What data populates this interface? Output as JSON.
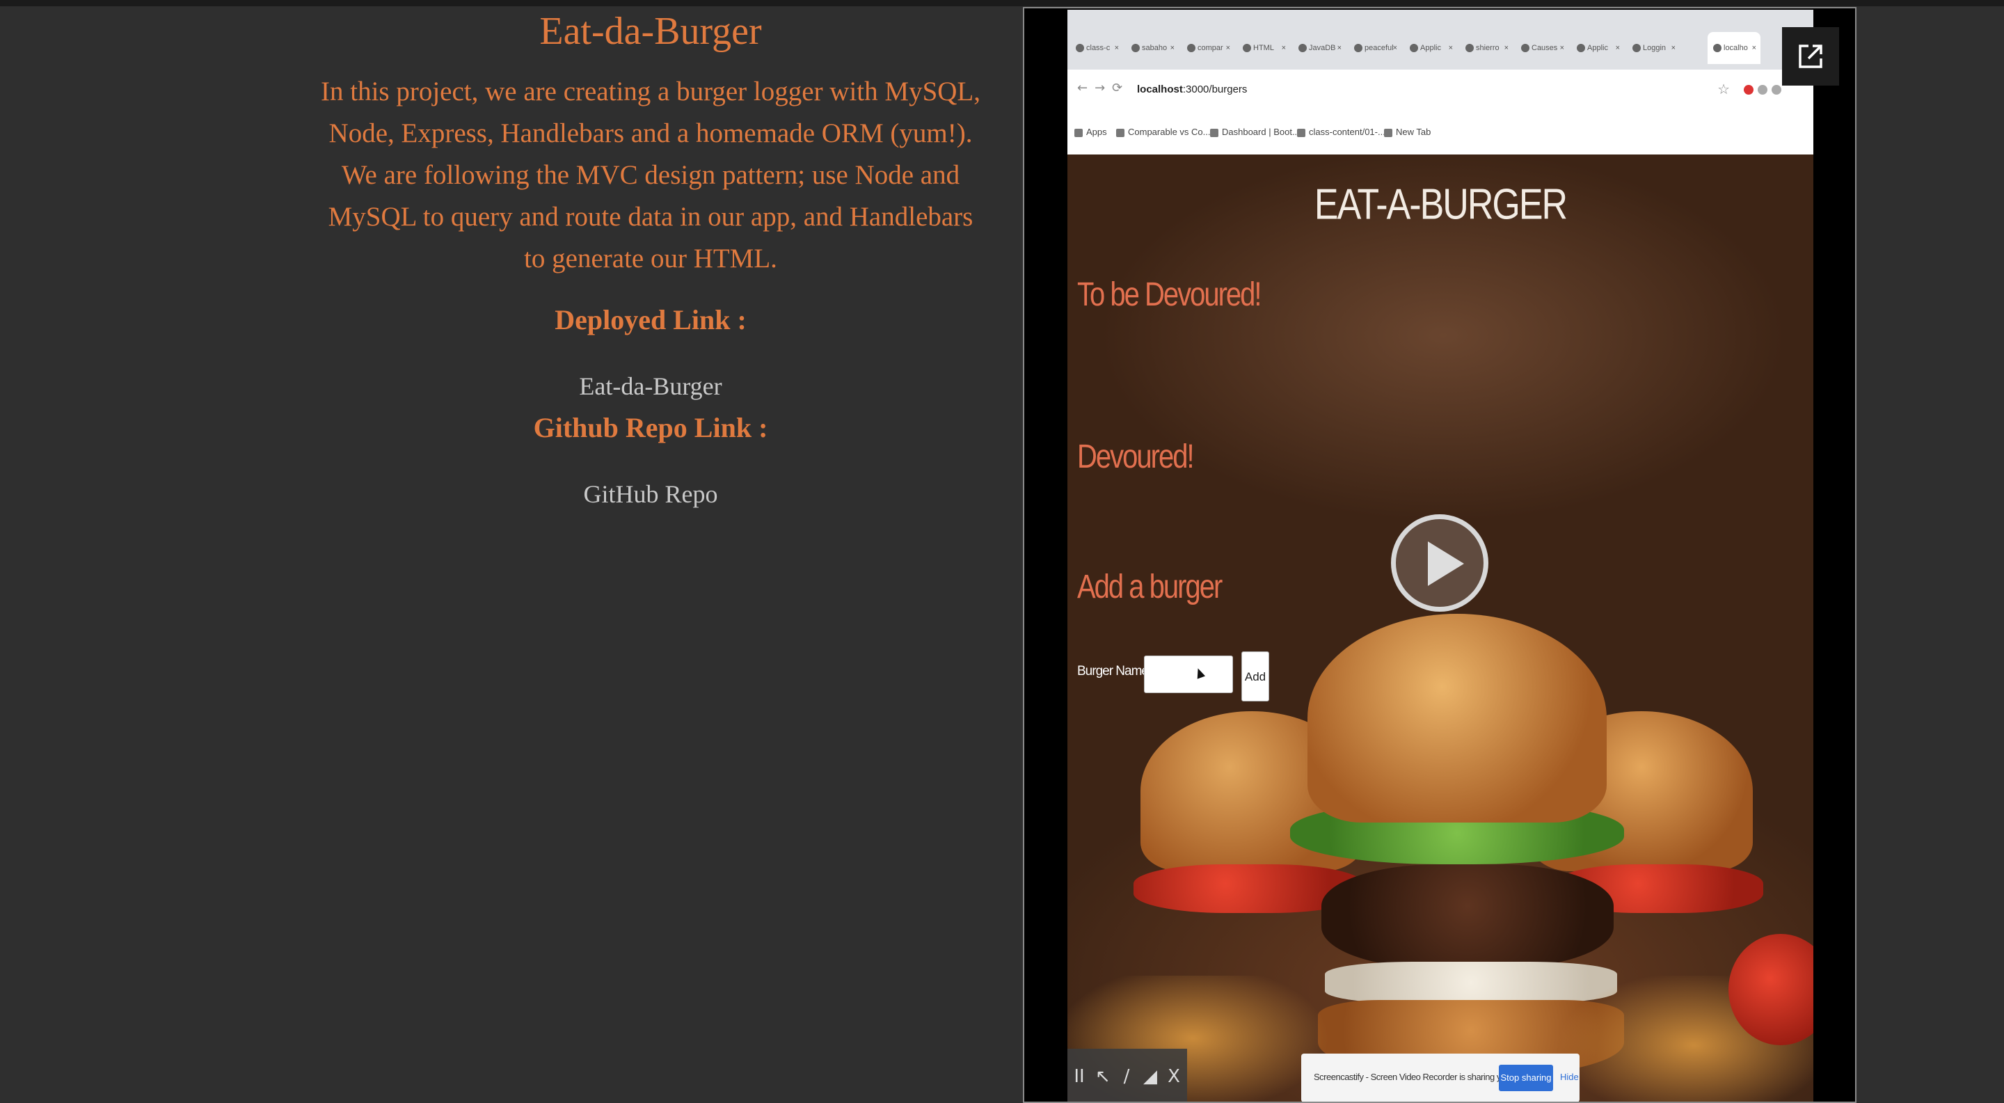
{
  "readme": {
    "title": "Eat-da-Burger",
    "description": "In this project, we are creating a burger logger with MySQL, Node, Express, Handlebars and a homemade ORM (yum!). We are following the MVC design pattern; use Node and MySQL to query and route data in our app, and Handlebars to generate our HTML.",
    "deployed_heading": "Deployed Link :",
    "deployed_link_text": "Eat-da-Burger",
    "github_heading": "Github Repo Link :",
    "github_link_text": "GitHub Repo"
  },
  "video": {
    "browser": {
      "tabs": [
        "class-c",
        "sabaho",
        "compar",
        "HTML",
        "JavaDB",
        "peaceful",
        "Applic",
        "shierro",
        "Causes",
        "Applic",
        "Loggin",
        "localho"
      ],
      "url_host": "localhost",
      "url_path": ":3000/burgers",
      "bookmarks": [
        "Apps",
        "Comparable vs Co...",
        "Dashboard | Boot...",
        "class-content/01-...",
        "New Tab"
      ]
    },
    "app": {
      "title": "EAT-A-BURGER",
      "to_be_devoured": "To be Devoured!",
      "devoured": "Devoured!",
      "add_burger": "Add a burger",
      "burger_name_label": "Burger Name:",
      "add_button": "Add"
    },
    "recorder": {
      "tools": [
        "II",
        "↖",
        "/",
        "◢",
        "X"
      ],
      "share_text": "Screencastify - Screen Video Recorder is sharing your screen.",
      "stop_sharing": "Stop sharing",
      "hide": "Hide"
    }
  },
  "colors": {
    "accent": "#e07a3f",
    "background": "#2f2f2f",
    "link": "#c9c9c9"
  }
}
